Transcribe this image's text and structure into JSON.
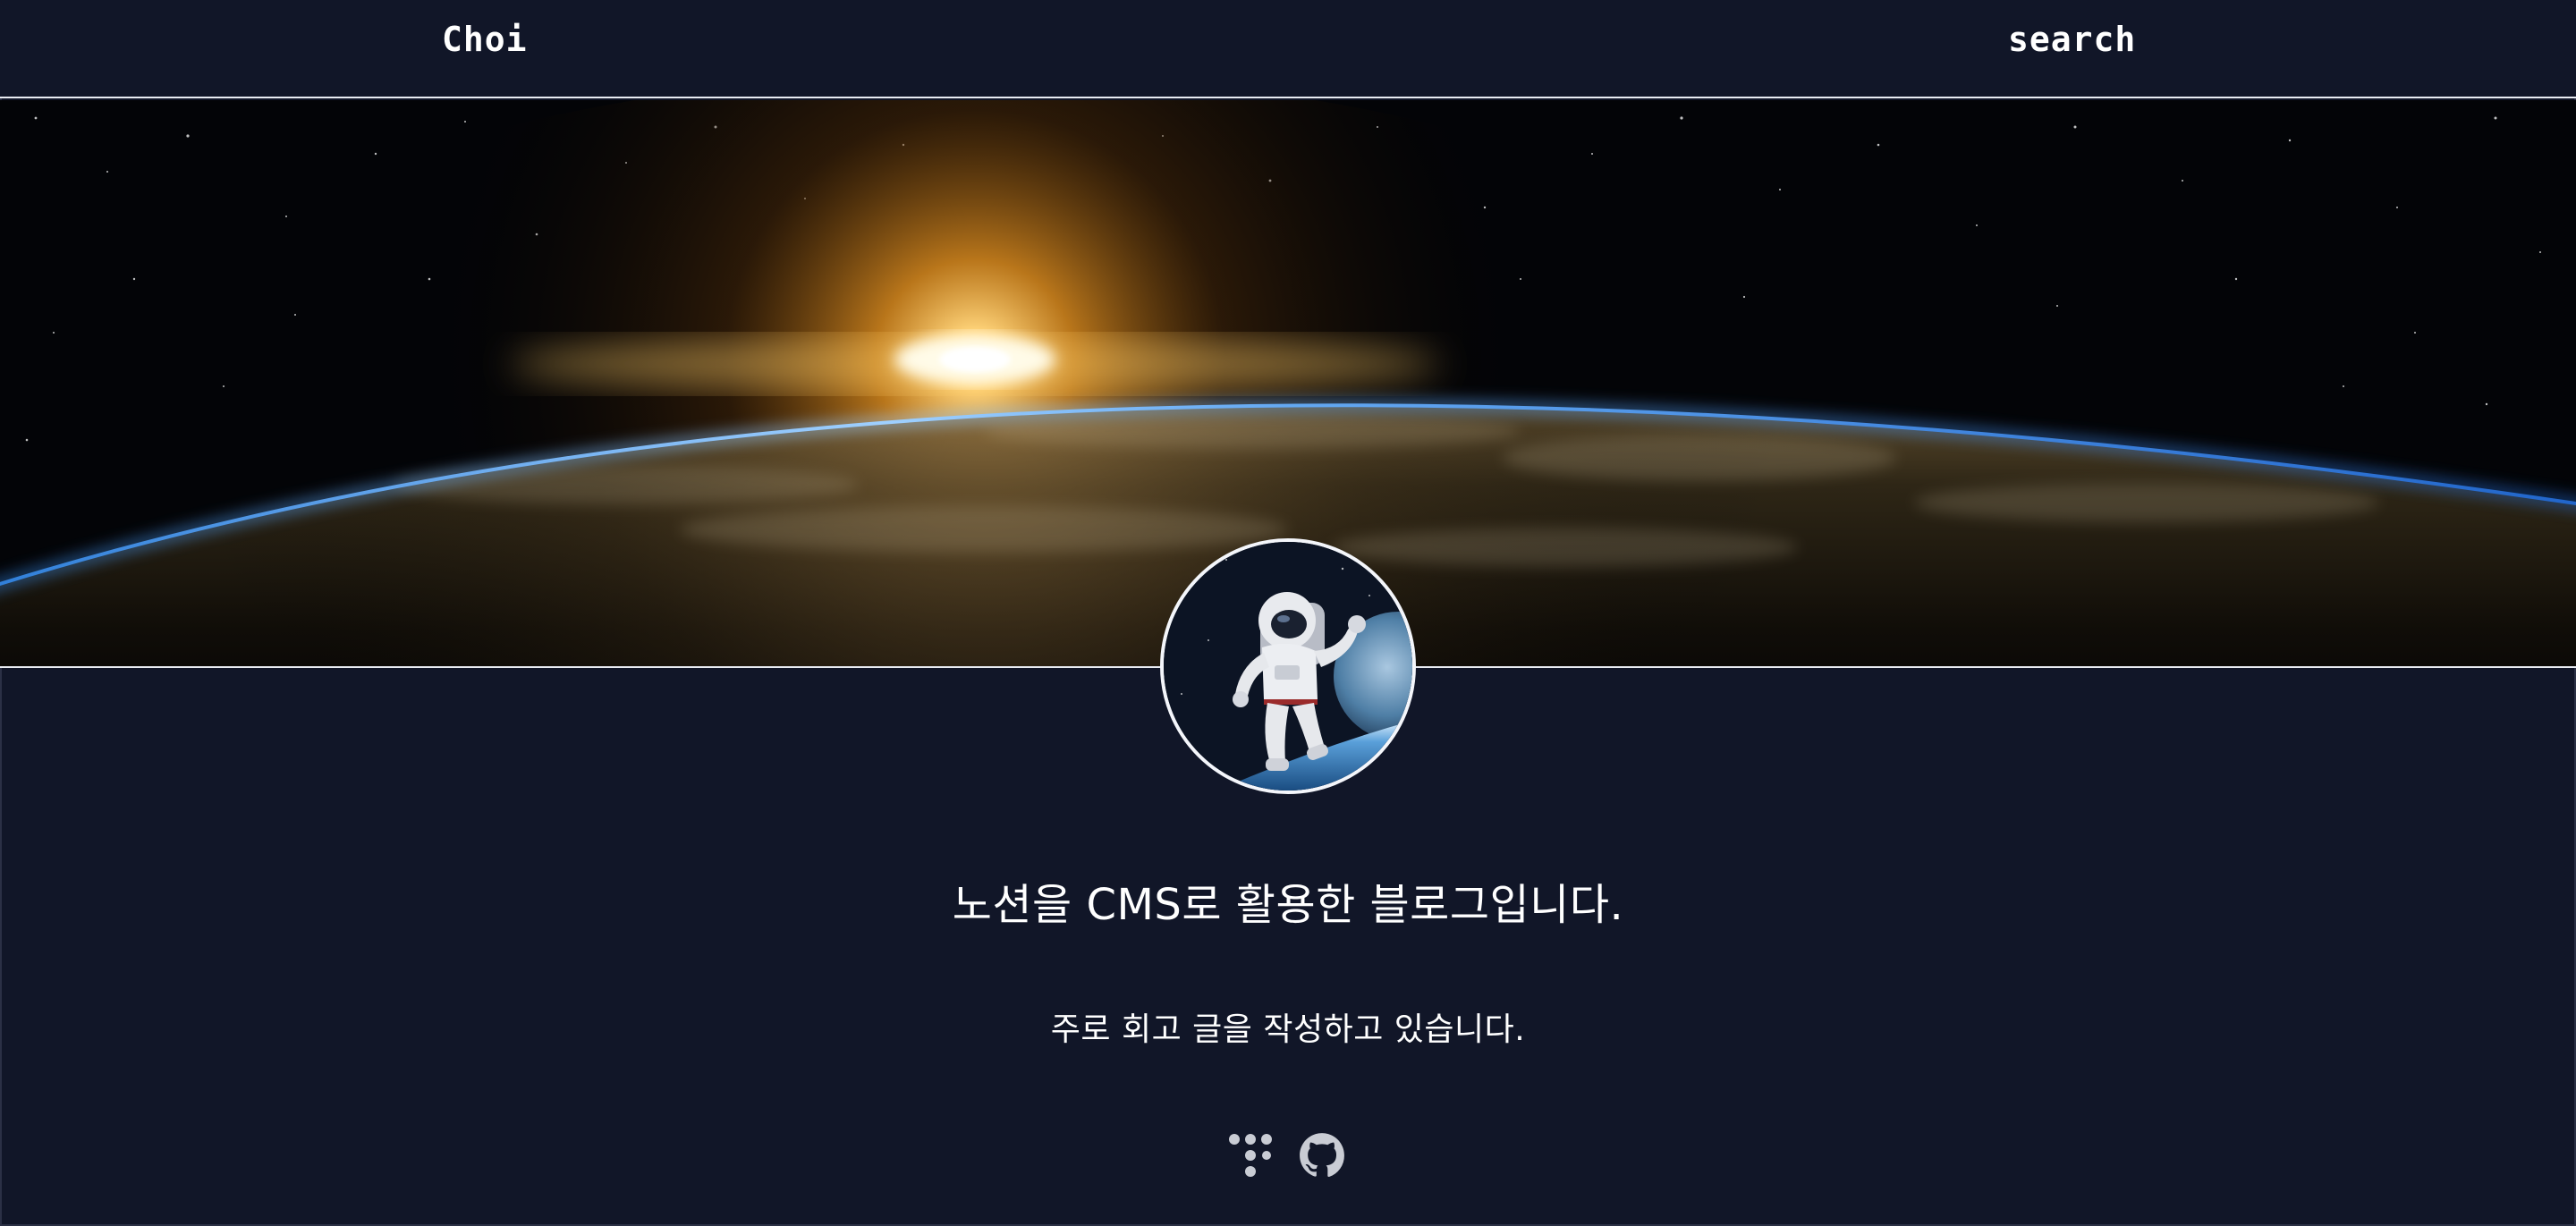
{
  "header": {
    "brand": "Choi",
    "search_label": "search"
  },
  "banner": {
    "image": "earth-horizon-sunrise-image"
  },
  "profile": {
    "avatar": "astronaut-avatar-image"
  },
  "main": {
    "headline": "노션을 CMS로 활용한 블로그입니다.",
    "subline": "주로 회고 글을 작성하고 있습니다."
  },
  "social": {
    "links": [
      {
        "icon": "tistory-icon"
      },
      {
        "icon": "github-icon"
      }
    ]
  },
  "colors": {
    "background": "#111628",
    "border": "#e9ecf3",
    "text": "#ffffff",
    "icon": "#c9ccd4"
  }
}
